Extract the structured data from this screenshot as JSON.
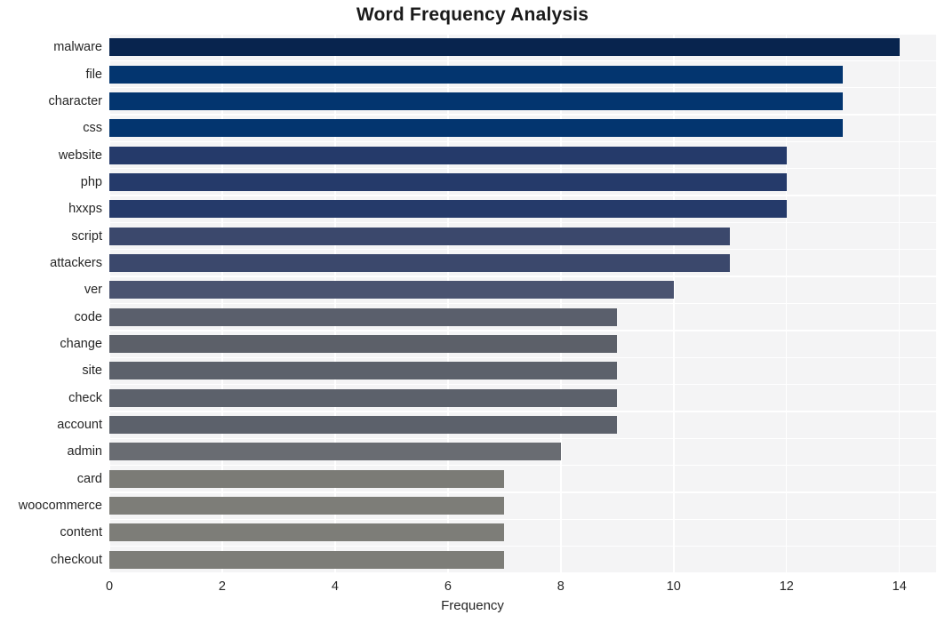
{
  "chart_data": {
    "type": "bar",
    "orientation": "horizontal",
    "title": "Word Frequency Analysis",
    "xlabel": "Frequency",
    "ylabel": "",
    "categories": [
      "malware",
      "file",
      "character",
      "css",
      "website",
      "php",
      "hxxps",
      "script",
      "attackers",
      "ver",
      "code",
      "change",
      "site",
      "check",
      "account",
      "admin",
      "card",
      "woocommerce",
      "content",
      "checkout"
    ],
    "values": [
      14,
      13,
      13,
      13,
      12,
      12,
      12,
      11,
      11,
      10,
      9,
      9,
      9,
      9,
      9,
      8,
      7,
      7,
      7,
      7
    ],
    "bar_colors": [
      "#08244e",
      "#03356f",
      "#03356f",
      "#03356f",
      "#253a6a",
      "#253a6a",
      "#253a6a",
      "#3b486c",
      "#3b486c",
      "#4a5370",
      "#5a5f6c",
      "#5c6069",
      "#5c616b",
      "#5c616b",
      "#5c616b",
      "#696c72",
      "#7b7b76",
      "#7d7d78",
      "#7d7d78",
      "#7d7d78"
    ],
    "xticks": [
      0,
      2,
      4,
      6,
      8,
      10,
      12,
      14
    ],
    "xtick_labels": [
      "0",
      "2",
      "4",
      "6",
      "8",
      "10",
      "12",
      "14"
    ],
    "xlim": [
      0,
      14.65
    ],
    "grid": true,
    "grid_color": "#ffffff",
    "plot_background": "#f4f4f5",
    "figure_background": "#ffffff",
    "legend": null
  }
}
